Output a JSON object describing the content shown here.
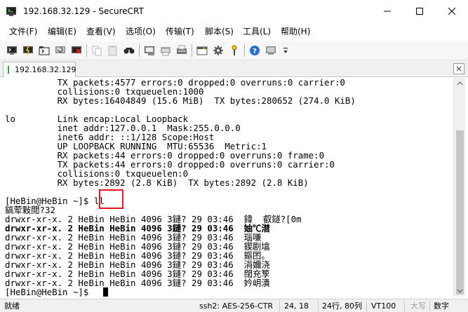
{
  "window": {
    "title": "192.168.32.129 - SecureCRT"
  },
  "menu": [
    "文件(F)",
    "编辑(E)",
    "查看(V)",
    "选项(O)",
    "传输(T)",
    "脚本(S)",
    "工具(L)",
    "帮助(H)"
  ],
  "tab": {
    "label": "192.168.32.129"
  },
  "terminal": {
    "lines": [
      {
        "text": "          TX packets:4577 errors:0 dropped:0 overruns:0 carrier:0",
        "bold": false
      },
      {
        "text": "          collisions:0 txqueuelen:1000",
        "bold": false
      },
      {
        "text": "          RX bytes:16404849 (15.6 MiB)  TX bytes:280652 (274.0 KiB)",
        "bold": false
      },
      {
        "text": "",
        "bold": false
      },
      {
        "text": "lo        Link encap:Local Loopback",
        "bold": false
      },
      {
        "text": "          inet addr:127.0.0.1  Mask:255.0.0.0",
        "bold": false
      },
      {
        "text": "          inet6 addr: ::1/128 Scope:Host",
        "bold": false
      },
      {
        "text": "          UP LOOPBACK RUNNING  MTU:65536  Metric:1",
        "bold": false
      },
      {
        "text": "          RX packets:44 errors:0 dropped:0 overruns:0 frame:0",
        "bold": false
      },
      {
        "text": "          TX packets:44 errors:0 dropped:0 overruns:0 carrier:0",
        "bold": false
      },
      {
        "text": "          collisions:0 txqueuelen:0",
        "bold": false
      },
      {
        "text": "          RX bytes:2892 (2.8 KiB)  TX bytes:2892 (2.8 KiB)",
        "bold": false
      },
      {
        "text": "",
        "bold": false
      },
      {
        "text": "[HeBin@HeBin ~]$ ll",
        "bold": false
      },
      {
        "text": "鎬荤敤閲?32",
        "bold": false
      },
      {
        "text": "drwxr-xr-x. 2 HeBin HeBin 4096 3鏈? 29 03:46  鍏  叡鐩?[0m",
        "bold": false
      },
      {
        "text": "drwxr-xr-x. 2 HeBin HeBin 4096 3鏈? 29 03:46  妯℃澘",
        "bold": true
      },
      {
        "text": "drwxr-xr-x. 2 HeBin HeBin 4096 3鏈? 29 03:46  瑙嗛",
        "bold": false
      },
      {
        "text": "drwxr-xr-x. 2 HeBin HeBin 4096 3鏈? 29 03:46  鍥剧墖",
        "bold": false
      },
      {
        "text": "drwxr-xr-x. 2 HeBin HeBin 4096 3鏈? 29 03:46  鏂囨。",
        "bold": false
      },
      {
        "text": "drwxr-xr-x. 2 HeBin HeBin 4096 3鏈? 29 03:46  涓嬭浇",
        "bold": false
      },
      {
        "text": "drwxr-xr-x. 2 HeBin HeBin 4096 3鏈? 29 03:46  闊充箰",
        "bold": false
      },
      {
        "text": "drwxr-xr-x. 2 HeBin HeBin 4096 3鏈? 29 03:46  妗岄潰",
        "bold": false
      },
      {
        "text": "[HeBin@HeBin ~]$ ",
        "bold": false
      }
    ]
  },
  "status": {
    "ready": "就绪",
    "protocol": "ssh2: AES-256-CTR",
    "cursor_position": "24, 18",
    "dimensions": "24行, 80列",
    "terminal_type": "VT100",
    "caps": "大写",
    "num": "数字"
  },
  "colors": {
    "highlight_box": "#e8141c",
    "connected_indicator": "#21a33a"
  },
  "icons": {
    "toolbar": [
      "connect-icon",
      "quick-connect-icon",
      "connect-in-tab-icon",
      "reconnect-icon",
      "disconnect-icon",
      "copy-icon",
      "paste-icon",
      "copy-paste-icon",
      "find-icon",
      "print-setup-icon",
      "print-icon",
      "print-screen-icon",
      "session-options-icon",
      "global-options-icon",
      "keymap-icon",
      "sftp-icon",
      "help-icon",
      "about-icon"
    ]
  }
}
